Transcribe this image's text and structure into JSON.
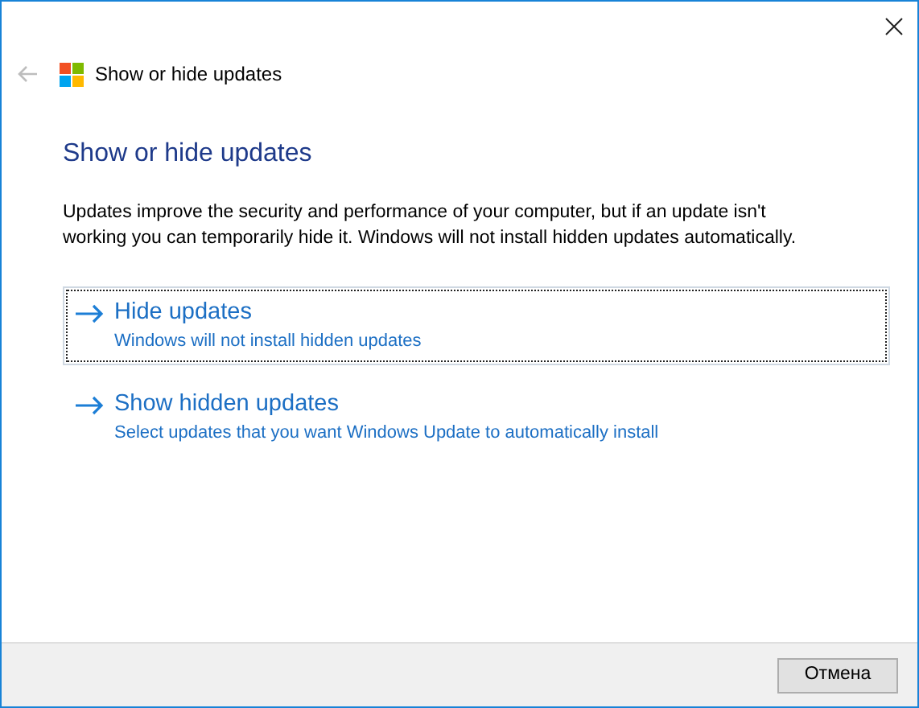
{
  "header": {
    "back_disabled": true,
    "title": "Show or hide updates"
  },
  "heading": "Show or hide updates",
  "description": "Updates improve the security and performance of your computer, but if an update isn't working you can temporarily hide it. Windows will not install hidden updates automatically.",
  "options": [
    {
      "title": "Hide updates",
      "subtitle": "Windows will not install hidden updates",
      "selected": true
    },
    {
      "title": "Show hidden updates",
      "subtitle": "Select updates that you want Windows Update to automatically install",
      "selected": false
    }
  ],
  "buttons": [
    "Отмена"
  ]
}
